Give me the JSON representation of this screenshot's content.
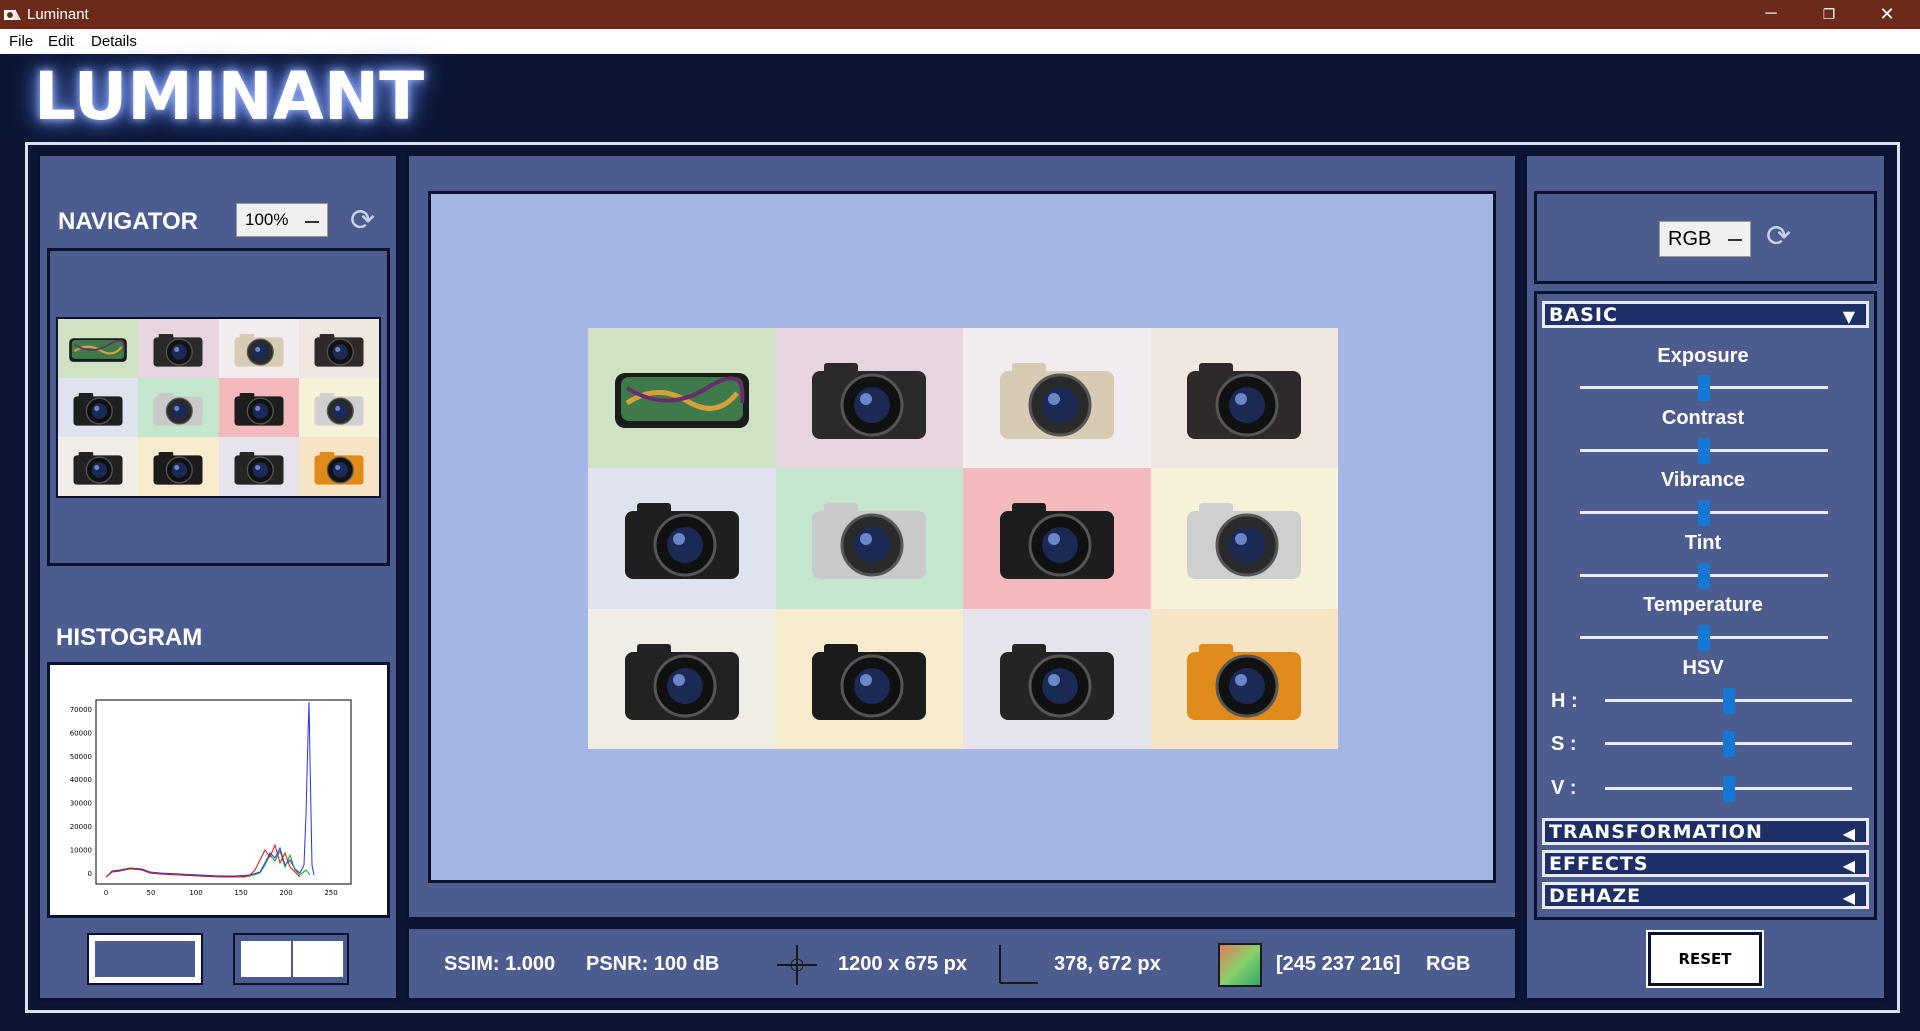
{
  "window": {
    "title": "Luminant",
    "minimize_label": "─",
    "maximize_label": "❐",
    "close_label": "✕"
  },
  "menu": {
    "file": "File",
    "edit": "Edit",
    "details": "Details"
  },
  "logo": "LUMINANT",
  "navigator": {
    "title": "NAVIGATOR",
    "zoom": "100%"
  },
  "histogram": {
    "title": "HISTOGRAM",
    "yticks": [
      "70000",
      "60000",
      "50000",
      "40000",
      "30000",
      "20000",
      "10000",
      "0"
    ],
    "xticks": [
      "0",
      "50",
      "100",
      "150",
      "200",
      "250"
    ]
  },
  "color_mode": "RGB",
  "sections": {
    "basic": "BASIC",
    "transformation": "TRANSFORMATION",
    "effects": "EFFECTS",
    "dehaze": "DEHAZE"
  },
  "sliders": {
    "exposure": {
      "label": "Exposure",
      "value": 0.5
    },
    "contrast": {
      "label": "Contrast",
      "value": 0.5
    },
    "vibrance": {
      "label": "Vibrance",
      "value": 0.5
    },
    "tint": {
      "label": "Tint",
      "value": 0.5
    },
    "temperature": {
      "label": "Temperature",
      "value": 0.5
    }
  },
  "hsv": {
    "label": "HSV",
    "h": {
      "label": "H :",
      "value": 0.5
    },
    "s": {
      "label": "S :",
      "value": 0.5
    },
    "v": {
      "label": "V :",
      "value": 0.5
    }
  },
  "reset_label": "RESET",
  "status": {
    "ssim": "SSIM: 1.000",
    "psnr": "PSNR: 100 dB",
    "size": "1200 x 675 px",
    "cursor": "378, 672 px",
    "pixel": "[245 237 216]",
    "mode": "RGB",
    "swatch_color": "#f5edd8"
  },
  "colors": {
    "accent": "#1478d4",
    "panel": "#4d5c8e",
    "canvas": "#a5b5e4",
    "titlebar": "#6b2a1a"
  }
}
